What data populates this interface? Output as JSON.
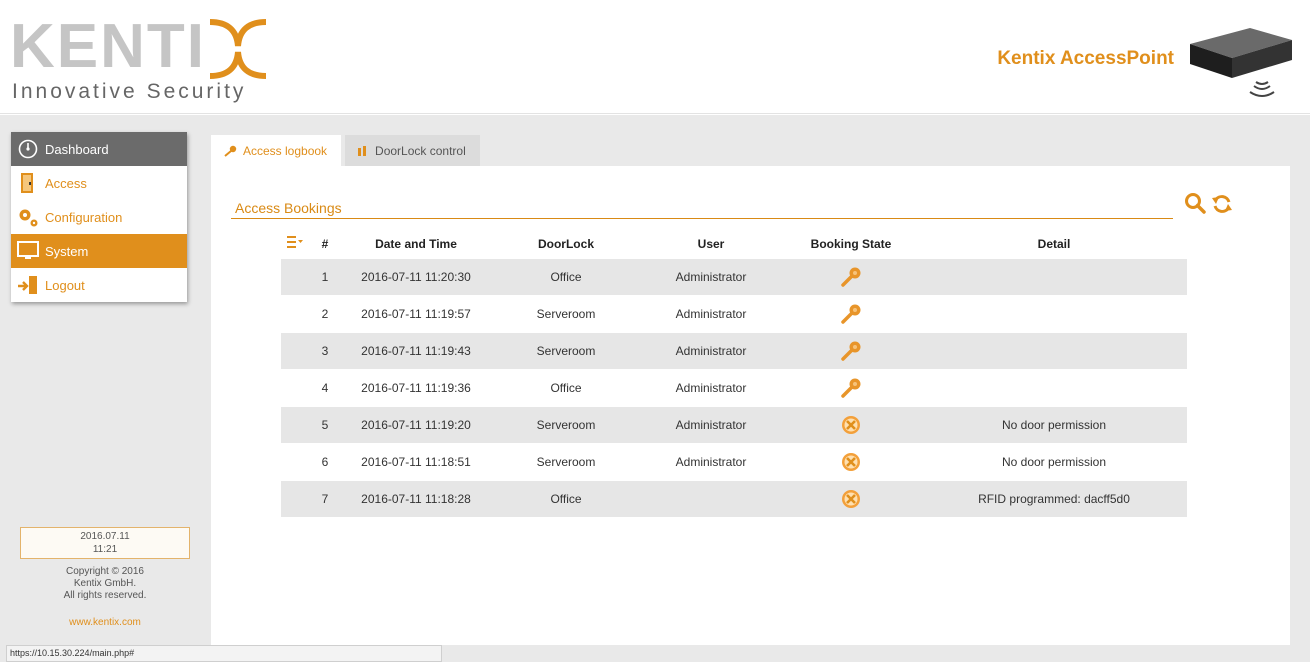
{
  "header": {
    "logo_text": "KENTIX",
    "logo_word": "KENTI",
    "tagline": "Innovative Security",
    "product_title": "Kentix AccessPoint",
    "device_icon": "accesspoint-device-icon"
  },
  "sidebar": {
    "items": [
      {
        "label": "Dashboard",
        "icon": "dashboard-gauge-icon"
      },
      {
        "label": "Access",
        "icon": "door-icon"
      },
      {
        "label": "Configuration",
        "icon": "gears-icon"
      },
      {
        "label": "System",
        "icon": "monitor-icon"
      },
      {
        "label": "Logout",
        "icon": "logout-icon"
      }
    ],
    "active_item": "System",
    "date": "2016.07.11",
    "time": "11:21",
    "copyright_lines": [
      "Copyright © 2016",
      "Kentix GmbH.",
      "All rights reserved."
    ],
    "website": "www.kentix.com"
  },
  "status_bar": {
    "url": "https://10.15.30.224/main.php#"
  },
  "tabs": [
    {
      "label": "Access logbook",
      "icon": "key-icon",
      "selected": true
    },
    {
      "label": "DoorLock control",
      "icon": "doorlock-icon",
      "selected": false
    }
  ],
  "section": {
    "title": "Access Bookings"
  },
  "table": {
    "columns": [
      "#",
      "Date and Time",
      "DoorLock",
      "User",
      "Booking State",
      "Detail"
    ],
    "rows": [
      {
        "num": "1",
        "datetime": "2016-07-11 11:20:30",
        "doorlock": "Office",
        "user": "Administrator",
        "state": "granted",
        "detail": ""
      },
      {
        "num": "2",
        "datetime": "2016-07-11 11:19:57",
        "doorlock": "Serveroom",
        "user": "Administrator",
        "state": "granted",
        "detail": ""
      },
      {
        "num": "3",
        "datetime": "2016-07-11 11:19:43",
        "doorlock": "Serveroom",
        "user": "Administrator",
        "state": "granted",
        "detail": ""
      },
      {
        "num": "4",
        "datetime": "2016-07-11 11:19:36",
        "doorlock": "Office",
        "user": "Administrator",
        "state": "granted",
        "detail": ""
      },
      {
        "num": "5",
        "datetime": "2016-07-11 11:19:20",
        "doorlock": "Serveroom",
        "user": "Administrator",
        "state": "denied",
        "detail": "No door permission"
      },
      {
        "num": "6",
        "datetime": "2016-07-11 11:18:51",
        "doorlock": "Serveroom",
        "user": "Administrator",
        "state": "denied",
        "detail": "No door permission"
      },
      {
        "num": "7",
        "datetime": "2016-07-11 11:18:28",
        "doorlock": "Office",
        "user": "",
        "state": "denied",
        "detail": "RFID programmed: dacff5d0"
      }
    ]
  },
  "colors": {
    "accent": "#e08f1c",
    "menu_header": "#6b6b6b",
    "row_shade": "#e6e6e6",
    "background": "#e9e9e9"
  }
}
